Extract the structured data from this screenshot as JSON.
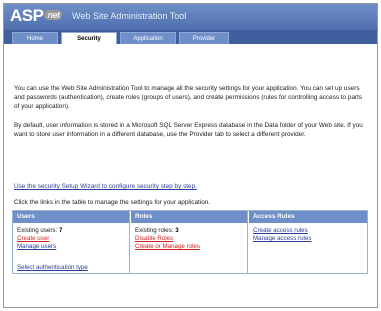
{
  "header": {
    "logo_text": "ASP",
    "logo_badge": "net",
    "title": "Web Site Administration Tool"
  },
  "tabs": [
    {
      "label": "Home",
      "active": false
    },
    {
      "label": "Security",
      "active": true
    },
    {
      "label": "Application",
      "active": false
    },
    {
      "label": "Provider",
      "active": false
    }
  ],
  "intro": {
    "paragraph1": "You can use the Web Site Administration Tool to manage all the security settings for your application. You can set up users and passwords (authentication), create roles (groups of users), and create permissions (rules for controlling access to parts of your application).",
    "paragraph2": "By default, user information is stored in a Microsoft SQL Server Express database in the Data folder of your Web site. If you want to store user information in a different database, use the Provider tab to select a different provider.",
    "wizard_link": "Use the security Setup Wizard to configure security step by step.",
    "instruction": "Click the links in the table to manage the settings for your application."
  },
  "management": {
    "users": {
      "header": "Users",
      "existing_label": "Existing users:",
      "existing_count": "7",
      "create_link": "Create user",
      "manage_link": "Manage users",
      "auth_link": "Select authentication type"
    },
    "roles": {
      "header": "Roles",
      "existing_label": "Existing roles:",
      "existing_count": "3",
      "disable_link": "Disable Roles",
      "create_manage_link": "Create or Manage roles"
    },
    "access_rules": {
      "header": "Access Rules",
      "create_link": "Create access rules",
      "manage_link": "Manage access rules"
    }
  },
  "colors": {
    "header_blue": "#4f6fae",
    "tab_blue": "#6f8fc8",
    "link_blue": "#2a3c9a",
    "link_red": "#cc2222"
  }
}
